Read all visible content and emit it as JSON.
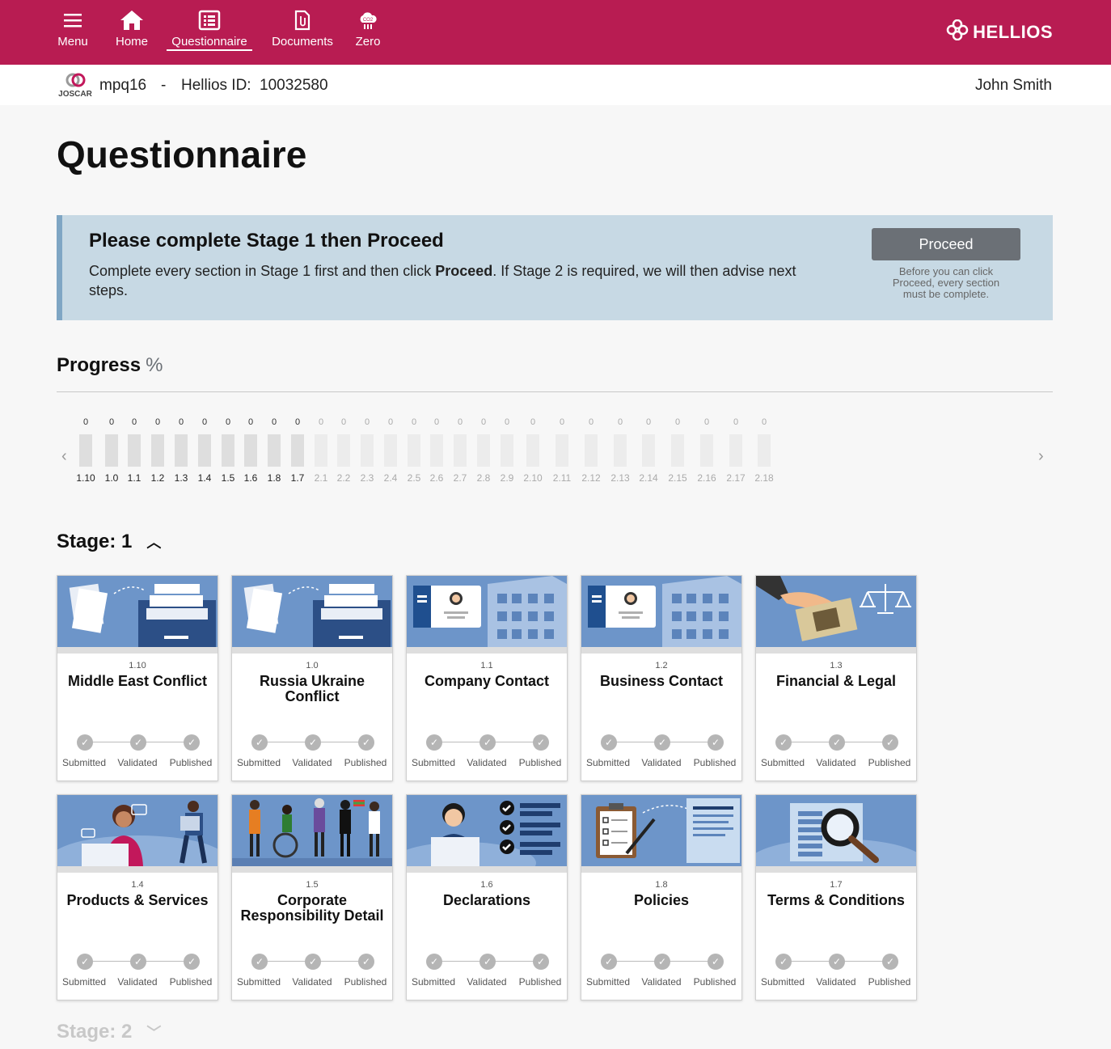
{
  "nav": {
    "items": [
      {
        "label": "Menu",
        "icon": "hamburger-icon"
      },
      {
        "label": "Home",
        "icon": "home-icon"
      },
      {
        "label": "Questionnaire",
        "icon": "list-icon"
      },
      {
        "label": "Documents",
        "icon": "document-icon"
      },
      {
        "label": "Zero",
        "icon": "co2-cloud-icon"
      }
    ],
    "active": "Questionnaire",
    "brand": "HELLIOS"
  },
  "subbar": {
    "logo_text": "JOSCAR",
    "account": "mpq16",
    "separator": "-",
    "id_label": "Hellios ID:",
    "id_value": "10032580",
    "user": "John Smith"
  },
  "page_title": "Questionnaire",
  "banner": {
    "title": "Please complete Stage 1 then Proceed",
    "text_before": "Complete every section in Stage 1 first and then click ",
    "text_bold": "Proceed",
    "text_after": ". If Stage 2 is required, we will then advise next steps.",
    "button": "Proceed",
    "note": "Before you can click Proceed, every section must be complete."
  },
  "progress": {
    "title": "Progress",
    "unit": "%",
    "bars": [
      {
        "label": "1.10",
        "value": "0"
      },
      {
        "label": "1.0",
        "value": "0"
      },
      {
        "label": "1.1",
        "value": "0"
      },
      {
        "label": "1.2",
        "value": "0"
      },
      {
        "label": "1.3",
        "value": "0"
      },
      {
        "label": "1.4",
        "value": "0"
      },
      {
        "label": "1.5",
        "value": "0"
      },
      {
        "label": "1.6",
        "value": "0"
      },
      {
        "label": "1.8",
        "value": "0"
      },
      {
        "label": "1.7",
        "value": "0"
      },
      {
        "label": "2.1",
        "value": "0"
      },
      {
        "label": "2.2",
        "value": "0"
      },
      {
        "label": "2.3",
        "value": "0"
      },
      {
        "label": "2.4",
        "value": "0"
      },
      {
        "label": "2.5",
        "value": "0"
      },
      {
        "label": "2.6",
        "value": "0"
      },
      {
        "label": "2.7",
        "value": "0"
      },
      {
        "label": "2.8",
        "value": "0"
      },
      {
        "label": "2.9",
        "value": "0"
      },
      {
        "label": "2.10",
        "value": "0"
      },
      {
        "label": "2.11",
        "value": "0"
      },
      {
        "label": "2.12",
        "value": "0"
      },
      {
        "label": "2.13",
        "value": "0"
      },
      {
        "label": "2.14",
        "value": "0"
      },
      {
        "label": "2.15",
        "value": "0"
      },
      {
        "label": "2.16",
        "value": "0"
      },
      {
        "label": "2.17",
        "value": "0"
      },
      {
        "label": "2.18",
        "value": "0"
      }
    ]
  },
  "stage1": {
    "label": "Stage: 1",
    "cards": [
      {
        "num": "1.10",
        "title": "Middle East Conflict",
        "img": "filing-cabinet"
      },
      {
        "num": "1.0",
        "title": "Russia Ukraine Conflict",
        "img": "filing-cabinet"
      },
      {
        "num": "1.1",
        "title": "Company Contact",
        "img": "id-card-building"
      },
      {
        "num": "1.2",
        "title": "Business Contact",
        "img": "id-card-building"
      },
      {
        "num": "1.3",
        "title": "Financial & Legal",
        "img": "money-scales"
      },
      {
        "num": "1.4",
        "title": "Products & Services",
        "img": "call-centre"
      },
      {
        "num": "1.5",
        "title": "Corporate Responsibility Detail",
        "img": "diverse-people"
      },
      {
        "num": "1.6",
        "title": "Declarations",
        "img": "checklist-person"
      },
      {
        "num": "1.8",
        "title": "Policies",
        "img": "clipboard-documents"
      },
      {
        "num": "1.7",
        "title": "Terms & Conditions",
        "img": "magnifier-document"
      }
    ],
    "step_labels": [
      "Submitted",
      "Validated",
      "Published"
    ]
  },
  "stage2": {
    "label": "Stage: 2"
  },
  "colors": {
    "brand": "#b81c52",
    "banner": "#c7d9e4",
    "card_image_bg": "#6d95c9",
    "button": "#6b7076"
  }
}
